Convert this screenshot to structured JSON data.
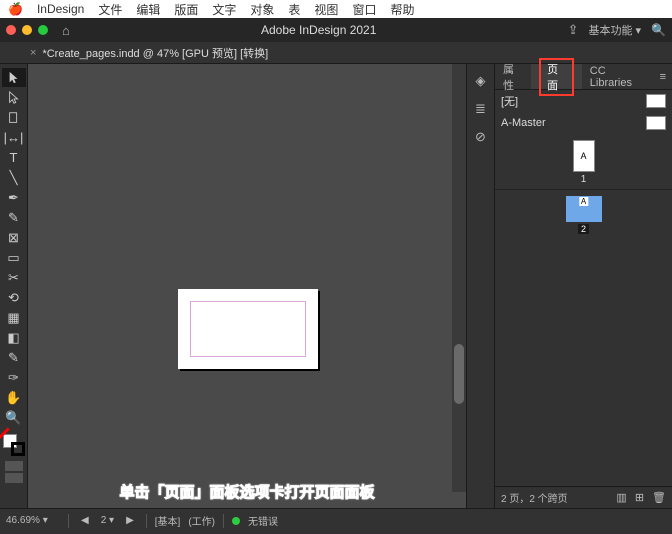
{
  "mac_menu": {
    "app": "InDesign",
    "items": [
      "文件",
      "编辑",
      "版面",
      "文字",
      "对象",
      "表",
      "视图",
      "窗口",
      "帮助"
    ]
  },
  "app": {
    "title": "Adobe InDesign 2021",
    "workspace": "基本功能",
    "share_icon": "share",
    "search_icon": "search"
  },
  "doc_tab": {
    "label": "*Create_pages.indd @ 47% [GPU 预览] [转换]"
  },
  "panel_tabs": {
    "properties": "属性",
    "pages": "页面",
    "cc": "CC Libraries"
  },
  "masters": {
    "none": "[无]",
    "a_master": "A-Master",
    "thumb_label": "1",
    "a_letter": "A"
  },
  "pages": {
    "current_thumb_letter": "A",
    "current_num": "2"
  },
  "panel_footer": {
    "status": "2 页，2 个跨页",
    "icons": [
      "grid",
      "new",
      "trash"
    ]
  },
  "status": {
    "zoom": "46.69%",
    "page_nav": "2",
    "errors": "无错误",
    "work": "(工作)",
    "basic": "[基本]"
  },
  "panel_strip_icons": [
    "properties",
    "layers",
    "links"
  ],
  "annotation": "单击「页面」面板选项卡打开页面面板",
  "tools": [
    "selection",
    "direct",
    "page",
    "gap",
    "type",
    "line",
    "pen",
    "pencil",
    "rect-frame",
    "rect",
    "scissors",
    "transform",
    "gradient",
    "note",
    "eyedropper",
    "hand",
    "zoom"
  ]
}
